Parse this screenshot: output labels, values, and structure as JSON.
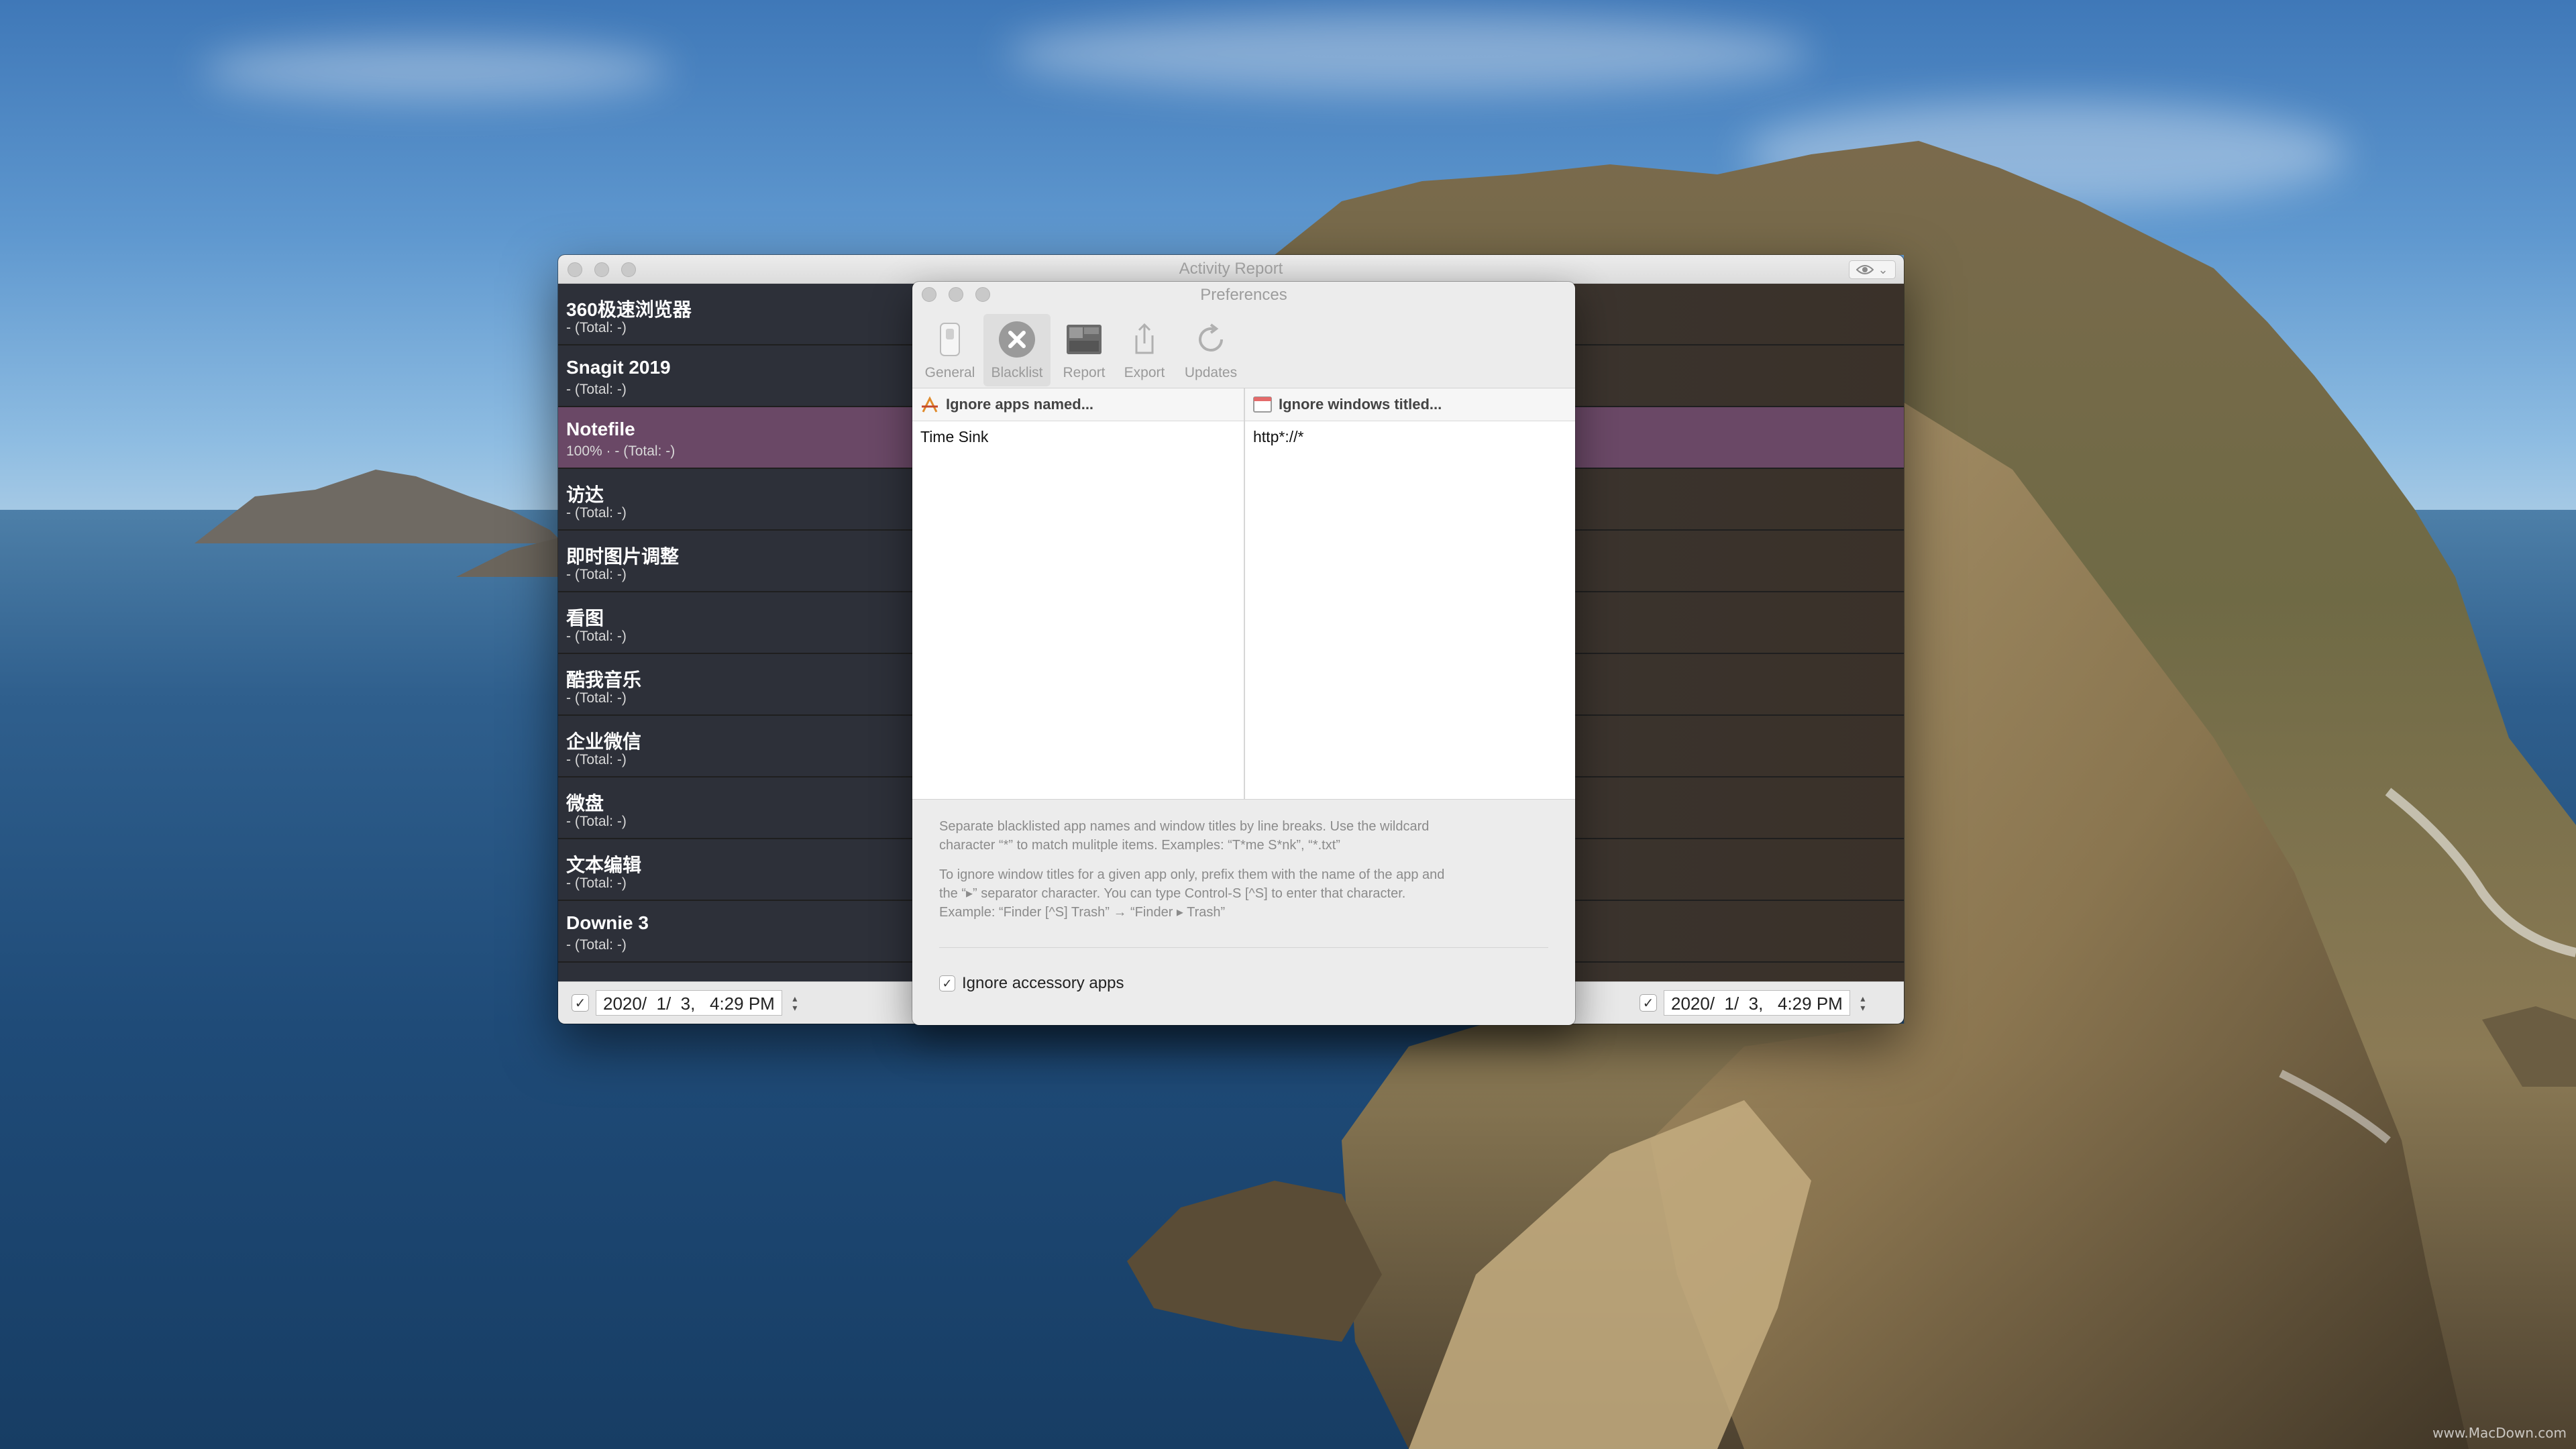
{
  "colors": {
    "selected_row": "#6a4866",
    "row_background": "#2d3039",
    "window_chrome": "#ececec"
  },
  "activity_report": {
    "title": "Activity Report",
    "eye_icon": "eye-icon",
    "apps": [
      {
        "name": "360极速浏览器",
        "total": "- (Total: -)"
      },
      {
        "name": "Snagit 2019",
        "total": "- (Total: -)"
      },
      {
        "name": "Notefile",
        "total": "100% · - (Total: -)"
      },
      {
        "name": "访达",
        "total": "- (Total: -)"
      },
      {
        "name": "即时图片调整",
        "total": "- (Total: -)"
      },
      {
        "name": "看图",
        "total": "- (Total: -)"
      },
      {
        "name": "酷我音乐",
        "total": "- (Total: -)"
      },
      {
        "name": "企业微信",
        "total": "- (Total: -)"
      },
      {
        "name": "微盘",
        "total": "- (Total: -)"
      },
      {
        "name": "文本编辑",
        "total": "- (Total: -)"
      },
      {
        "name": "Downie 3",
        "total": "- (Total: -)"
      }
    ],
    "selected_index": 2,
    "start_date": "2020/  1/  3,   4:29 PM",
    "end_date": "2020/  1/  3,   4:29 PM",
    "start_checked": "✓",
    "end_checked": "✓"
  },
  "preferences": {
    "title": "Preferences",
    "toolbar": [
      {
        "label": "General",
        "icon": "switch-icon"
      },
      {
        "label": "Blacklist",
        "icon": "x-circle-icon"
      },
      {
        "label": "Report",
        "icon": "report-icon"
      },
      {
        "label": "Export",
        "icon": "share-icon"
      },
      {
        "label": "Updates",
        "icon": "refresh-icon"
      }
    ],
    "active_tab": "Blacklist",
    "apps_header": "Ignore apps named...",
    "windows_header": "Ignore windows titled...",
    "apps_list": [
      "Time Sink"
    ],
    "windows_list": [
      "http*://*"
    ],
    "help_1_line1": "Separate blacklisted app names and window titles by line breaks. Use the wildcard",
    "help_1_line2": "character “*” to match mulitple items. Examples: “T*me S*nk”, “*.txt”",
    "help_2_line1": "To ignore window titles for a given app only, prefix them with the name of the app and",
    "help_2_line2": "the “▸” separator character. You can type Control-S [^S] to enter that character.",
    "help_2_line3": "Example: “Finder [^S] Trash” → “Finder ▸ Trash”",
    "ignore_accessory_label": "Ignore accessory apps",
    "ignore_accessory_checked": "✓"
  },
  "watermark": "www.MacDown.com"
}
